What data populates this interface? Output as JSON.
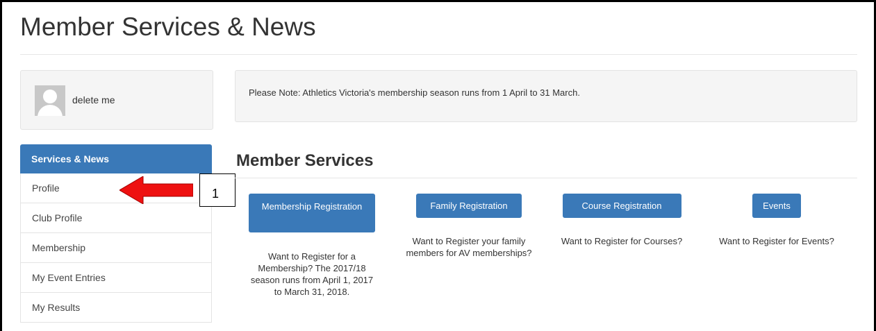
{
  "page": {
    "title": "Member Services & News"
  },
  "user": {
    "name": "delete me"
  },
  "notice": {
    "text": "Please Note: Athletics Victoria's membership season runs from 1 April to 31 March."
  },
  "sidebar": {
    "items": [
      {
        "label": "Services & News",
        "active": true
      },
      {
        "label": "Profile"
      },
      {
        "label": "Club Profile"
      },
      {
        "label": "Membership"
      },
      {
        "label": "My Event Entries"
      },
      {
        "label": "My Results"
      }
    ]
  },
  "annotation": {
    "number": "1",
    "arrow_color": "#ee1111"
  },
  "section": {
    "title": "Member Services"
  },
  "services": [
    {
      "button": "Membership Registration",
      "description": "Want to Register for a Membership? The 2017/18 season runs from April 1, 2017 to March 31, 2018."
    },
    {
      "button": "Family Registration",
      "description": "Want to Register your family members for AV memberships?"
    },
    {
      "button": "Course Registration",
      "description": "Want to Register for Courses?"
    },
    {
      "button": "Events",
      "description": "Want to Register for Events?"
    }
  ],
  "colors": {
    "accent": "#3a79b8",
    "panel": "#f5f5f5"
  }
}
